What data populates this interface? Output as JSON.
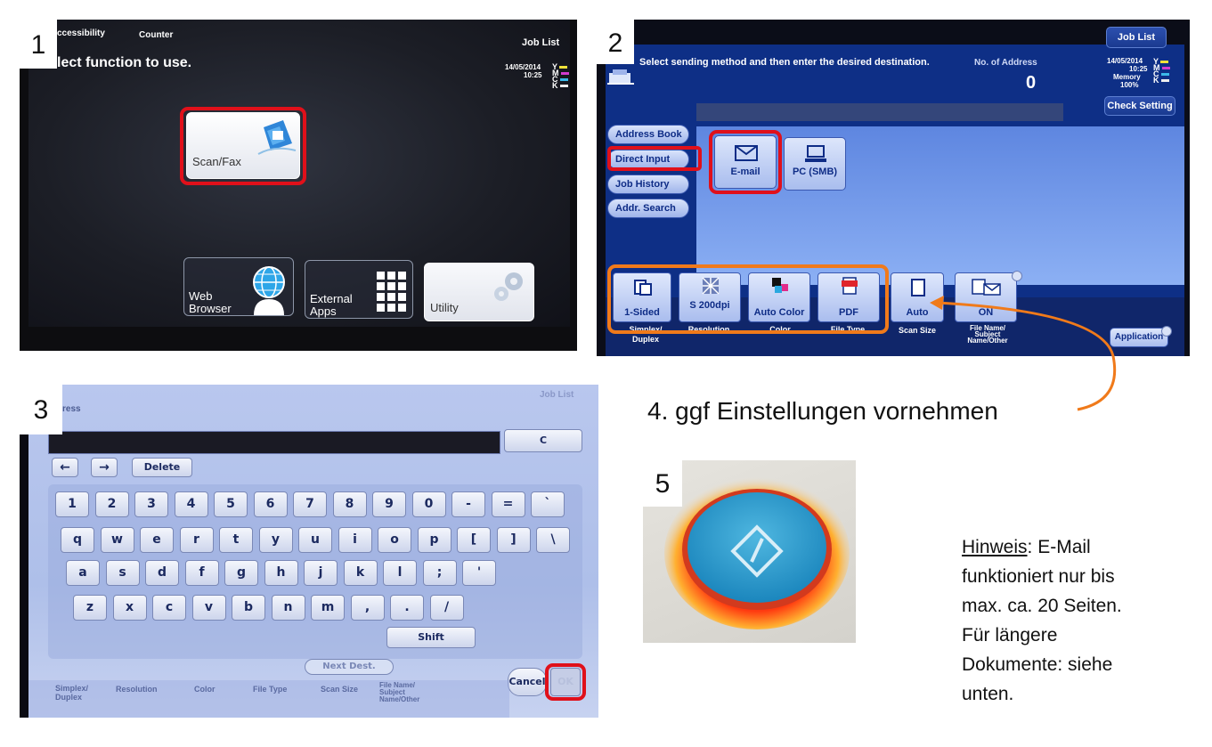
{
  "steps": {
    "s1": "1",
    "s2": "2",
    "s3": "3",
    "s5": "5",
    "s4_text": "4. ggf Einstellungen vornehmen"
  },
  "panel1": {
    "accessibility": "ccessibility",
    "counter": "Counter",
    "job_list": "Job List",
    "prompt": "lect function to use.",
    "date": "14/05/2014",
    "time": "10:25",
    "ymck": [
      "Y",
      "M",
      "C",
      "K"
    ],
    "tile_scan": "Scan/Fax",
    "tile_web": [
      "Web",
      "Browser"
    ],
    "tile_ext": [
      "External",
      "Apps"
    ],
    "tile_util": "Utility"
  },
  "panel2": {
    "job_list": "Job List",
    "instruction": "Select sending method and then enter the desired destination.",
    "no_address_label": "No. of Address",
    "no_address_value": "0",
    "date": "14/05/2014",
    "time": "10:25",
    "memory": "Memory",
    "memory_pct": "100%",
    "ymck": [
      "Y",
      "M",
      "C",
      "K"
    ],
    "check_setting": "Check Setting",
    "nav": [
      "Address Book",
      "Direct Input",
      "Job History",
      "Addr. Search"
    ],
    "dest_email": "E-mail",
    "dest_pc": "PC (SMB)",
    "settings": [
      "1-Sided",
      "S 200dpi",
      "Auto Color",
      "PDF",
      "Auto",
      "ON"
    ],
    "setting_labels": [
      "Simplex/",
      "Duplex",
      "Resolution",
      "Color",
      "File Type",
      "Scan Size",
      "File Name/",
      "Subject",
      "Name/Other"
    ],
    "application": "Application"
  },
  "panel3": {
    "job_list": "Job List",
    "title": "ress",
    "clear": "C",
    "left": "←",
    "right": "→",
    "delete": "Delete",
    "row1": [
      "1",
      "2",
      "3",
      "4",
      "5",
      "6",
      "7",
      "8",
      "9",
      "0",
      "-",
      "=",
      "`"
    ],
    "row2": [
      "q",
      "w",
      "e",
      "r",
      "t",
      "y",
      "u",
      "i",
      "o",
      "p",
      "[",
      "]",
      "\\"
    ],
    "row3": [
      "a",
      "s",
      "d",
      "f",
      "g",
      "h",
      "j",
      "k",
      "l",
      ";",
      "'"
    ],
    "row4": [
      "z",
      "x",
      "c",
      "v",
      "b",
      "n",
      "m",
      ",",
      ".",
      "/"
    ],
    "shift": "Shift",
    "next_dest": "Next Dest.",
    "cancel": "Cancel",
    "ok": "OK",
    "bottom_labels": [
      "Simplex/",
      "Duplex",
      "Resolution",
      "Color",
      "File Type",
      "Scan Size",
      "File Name/",
      "Subject",
      "Name/Other"
    ]
  },
  "hint": {
    "label": "Hinweis",
    "lines": [
      ": E-Mail",
      "funktioniert nur bis",
      "max. ca. 20 Seiten.",
      "Für längere",
      "Dokumente: siehe",
      "unten."
    ]
  },
  "colors": {
    "red_highlight": "#e0101a",
    "orange_highlight": "#f07a1a",
    "screen_blue": "#0e2f86"
  }
}
